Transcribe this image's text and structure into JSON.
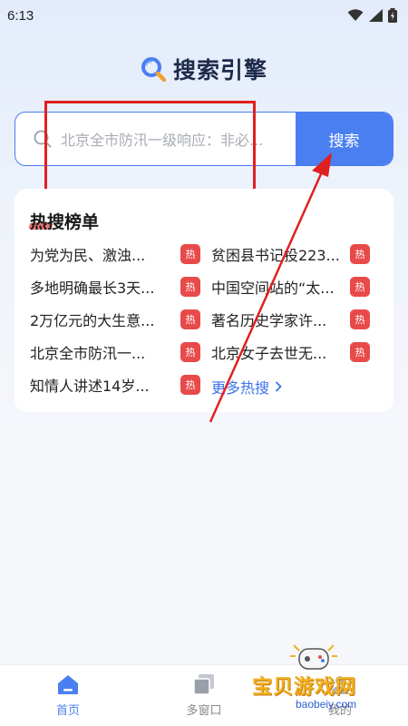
{
  "status_bar": {
    "time": "6:13"
  },
  "header": {
    "title": "搜索引擎",
    "logo_icon": "search-logo-icon"
  },
  "search": {
    "placeholder": "北京全市防汛一级响应：非必...",
    "button_label": "搜索"
  },
  "hot_list": {
    "title": "热搜榜单",
    "badge": "热",
    "items": [
      {
        "text": "为党为民、激浊..."
      },
      {
        "text": "贫困县书记投223..."
      },
      {
        "text": "多地明确最长3天..."
      },
      {
        "text": "中国空间站的“太..."
      },
      {
        "text": "2万亿元的大生意..."
      },
      {
        "text": "著名历史学家许..."
      },
      {
        "text": "北京全市防汛一..."
      },
      {
        "text": "北京女子去世无..."
      },
      {
        "text": "知情人讲述14岁..."
      }
    ],
    "more_label": "更多热搜"
  },
  "tabs": [
    {
      "label": "首页",
      "icon": "home-icon",
      "active": true
    },
    {
      "label": "多窗口",
      "icon": "windows-icon",
      "active": false
    },
    {
      "label": "我的",
      "icon": "profile-icon",
      "active": false
    }
  ],
  "watermark": {
    "text": "宝贝游戏网",
    "url": "baobeiy.com"
  },
  "colors": {
    "accent": "#4a7ff2",
    "hot_badge": "#e84a4a",
    "annotation": "#e02020"
  }
}
